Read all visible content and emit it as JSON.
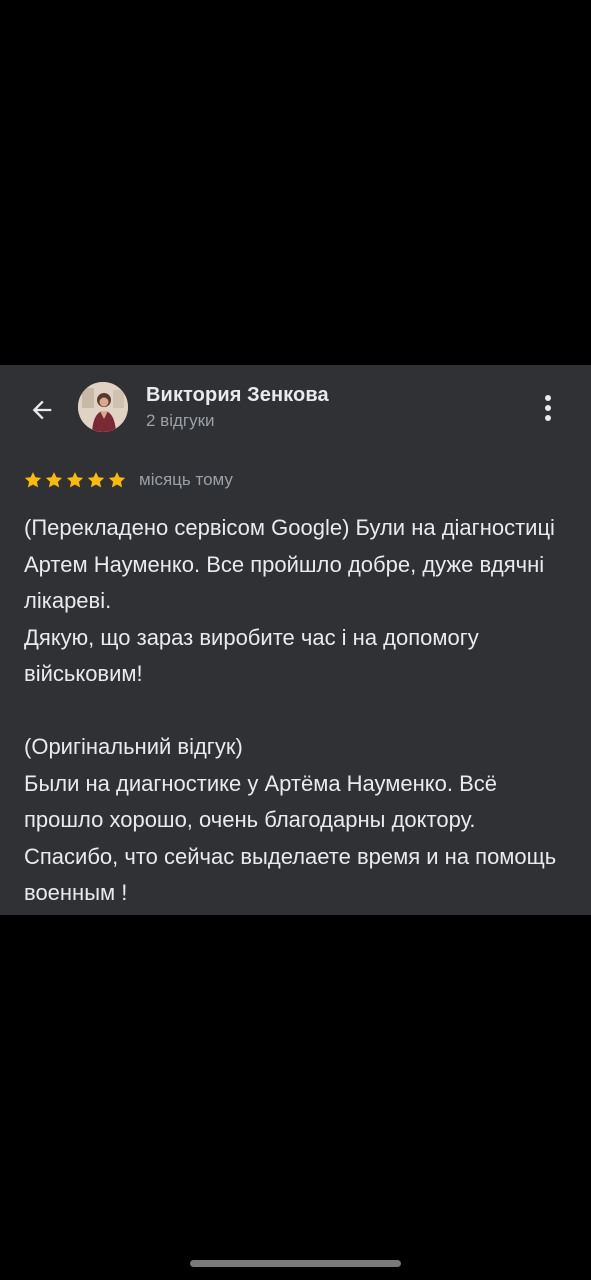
{
  "review": {
    "reviewer_name": "Виктория Зенкова",
    "review_count": "2 відгуки",
    "rating": 5,
    "max_rating": 5,
    "date": "місяць тому",
    "text": "(Перекладено сервісом Google) Були на діагностиці Артем Науменко. Все пройшло добре, дуже вдячні лікареві.\nДякую, що зараз виробите час і на допомогу військовим!\n\n(Оригінальний відгук)\nБыли на диагностике у Артёма Науменко. Всё прошло хорошо, очень благодарны доктору. Спасибо, что сейчас выделаете время и на помощь военным !"
  },
  "icons": {
    "back": "arrow-back-icon",
    "more": "more-vert-icon",
    "star": "star-icon"
  },
  "colors": {
    "card_background": "#303134",
    "star": "#fbbc04",
    "primary_text": "#e8eaed",
    "secondary_text": "#9aa0a6"
  }
}
